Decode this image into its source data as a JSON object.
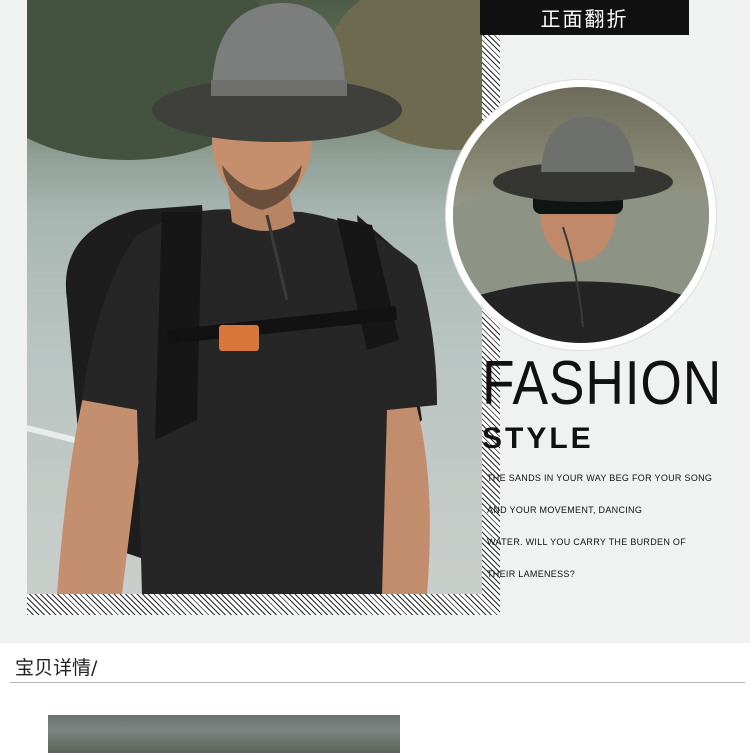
{
  "label": "正面翻折",
  "headline": "FASHION",
  "subheadline": "STYLE",
  "lines": [
    "THE SANDS IN YOUR WAY BEG FOR YOUR SONG",
    "AND YOUR MOVEMENT, DANCING",
    "WATER. WILL YOU CARRY THE BURDEN OF",
    "THEIR LAMENESS?"
  ],
  "section_title": "宝贝详情/"
}
